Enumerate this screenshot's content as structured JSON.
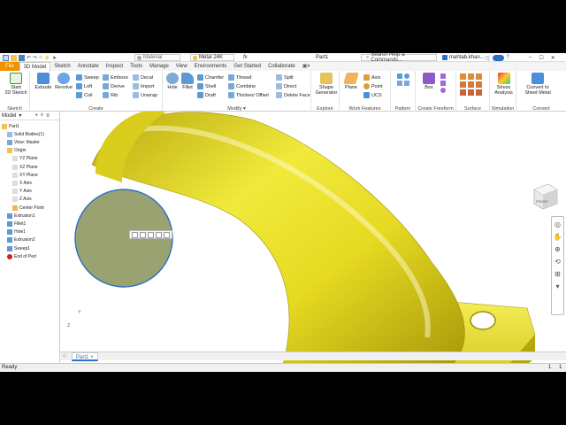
{
  "title_bar": {
    "material": "Material",
    "appearance": "Metal 24K",
    "fx": "fx",
    "doc_title": "Part1",
    "search_placeholder": "Search Help & Commands...",
    "user": "mahtab.khan...",
    "icon_names": [
      "new-icon",
      "open-icon",
      "save-icon",
      "undo-icon",
      "redo-icon",
      "home-icon",
      "update-icon",
      "select-icon"
    ]
  },
  "ribbon_tabs": [
    "File",
    "3D Model",
    "Sketch",
    "Annotate",
    "Inspect",
    "Tools",
    "Manage",
    "View",
    "Environments",
    "Get Started",
    "Collaborate"
  ],
  "active_tab": "3D Model",
  "ribbon": {
    "sketch": {
      "label": "Sketch",
      "start_line1": "Start",
      "start_line2": "2D Sketch"
    },
    "create": {
      "label": "Create",
      "extrude": "Extrude",
      "revolve": "Revolve",
      "sweep": "Sweep",
      "loft": "Loft",
      "coil": "Coil",
      "emboss": "Emboss",
      "derive": "Derive",
      "rib": "Rib",
      "decal": "Decal",
      "import": "Import",
      "unwrap": "Unwrap"
    },
    "modify": {
      "label": "Modify",
      "hole": "Hole",
      "fillet": "Fillet",
      "chamfer": "Chamfer",
      "shell": "Shell",
      "draft": "Draft",
      "thread": "Thread",
      "combine": "Combine",
      "thicken": "Thicken/ Offset",
      "split": "Split",
      "direct": "Direct",
      "delete_face": "Delete Face"
    },
    "explore": {
      "label": "Explore",
      "shape_gen_line1": "Shape",
      "shape_gen_line2": "Generator"
    },
    "work_features": {
      "label": "Work Features",
      "plane": "Plane",
      "axis": "Axis",
      "point": "Point",
      "ucs": "UCS"
    },
    "pattern": {
      "label": "Pattern"
    },
    "freeform": {
      "label": "Create Freeform",
      "box": "Box"
    },
    "surface": {
      "label": "Surface"
    },
    "simulation": {
      "label": "Simulation",
      "stress_line1": "Stress",
      "stress_line2": "Analysis"
    },
    "convert": {
      "label": "Convert",
      "convert_line1": "Convert to",
      "convert_line2": "Sheet Metal"
    }
  },
  "browser": {
    "title": "Model",
    "tree": [
      {
        "label": "Part1",
        "indent": 0
      },
      {
        "label": "Solid Bodies(1)",
        "indent": 1
      },
      {
        "label": "View: Master",
        "indent": 1
      },
      {
        "label": "Origin",
        "indent": 1
      },
      {
        "label": "YZ Plane",
        "indent": 2
      },
      {
        "label": "XZ Plane",
        "indent": 2
      },
      {
        "label": "XY Plane",
        "indent": 2
      },
      {
        "label": "X Axis",
        "indent": 2
      },
      {
        "label": "Y Axis",
        "indent": 2
      },
      {
        "label": "Z Axis",
        "indent": 2
      },
      {
        "label": "Center Point",
        "indent": 2
      },
      {
        "label": "Extrusion1",
        "indent": 1
      },
      {
        "label": "Fillet1",
        "indent": 1
      },
      {
        "label": "Hole1",
        "indent": 1
      },
      {
        "label": "Extrusion2",
        "indent": 1
      },
      {
        "label": "Sweep1",
        "indent": 1
      },
      {
        "label": "End of Part",
        "indent": 1
      }
    ]
  },
  "viewcube": {
    "label": "FRONT"
  },
  "triad": {
    "z": "Z",
    "y": "Y"
  },
  "doc_tabs": {
    "home": "home-icon",
    "part": "Part1"
  },
  "status": {
    "text": "Ready",
    "count1": "1",
    "count2": "1"
  },
  "colors": {
    "file_tab": "#f29100",
    "gold": "#e8de2a",
    "face": "#9aa272",
    "accent": "#2b6fc0"
  }
}
